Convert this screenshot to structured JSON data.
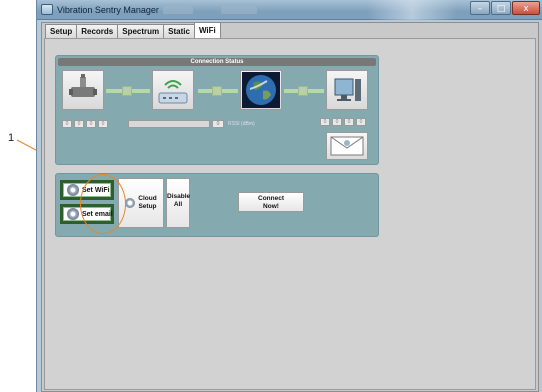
{
  "callout": {
    "label": "1"
  },
  "window": {
    "title": "Vibration Sentry Manager",
    "buttons": {
      "minimize": "–",
      "maximize": "□",
      "close": "x"
    }
  },
  "tabs": [
    {
      "label": "Setup",
      "active": false
    },
    {
      "label": "Records",
      "active": false
    },
    {
      "label": "Spectrum",
      "active": false
    },
    {
      "label": "Static",
      "active": false
    },
    {
      "label": "WiFi",
      "active": true
    }
  ],
  "connection": {
    "header": "Connection Status",
    "left_ip_fields": [
      "0",
      "0",
      "0",
      "0"
    ],
    "rssi_value": "0",
    "rssi_label": "RSSI (dBm)",
    "right_ip_fields": [
      "0",
      "0",
      "0",
      "0"
    ],
    "devices": [
      "sensor-icon",
      "router-icon",
      "earth-icon",
      "computer-icon"
    ],
    "link_color": "#b7d9a3"
  },
  "actions": {
    "set_wifi": "Set WiFi",
    "set_email": "Set email",
    "cloud_setup_line1": "Cloud",
    "cloud_setup_line2": "Setup",
    "disable_all_line1": "Disable",
    "disable_all_line2": "All",
    "connect_now_line1": "Connect",
    "connect_now_line2": "Now!"
  },
  "colors": {
    "panel": "#84aab0",
    "highlight_ring": "#e8862a",
    "green_button_border": "#2e5e2e"
  }
}
